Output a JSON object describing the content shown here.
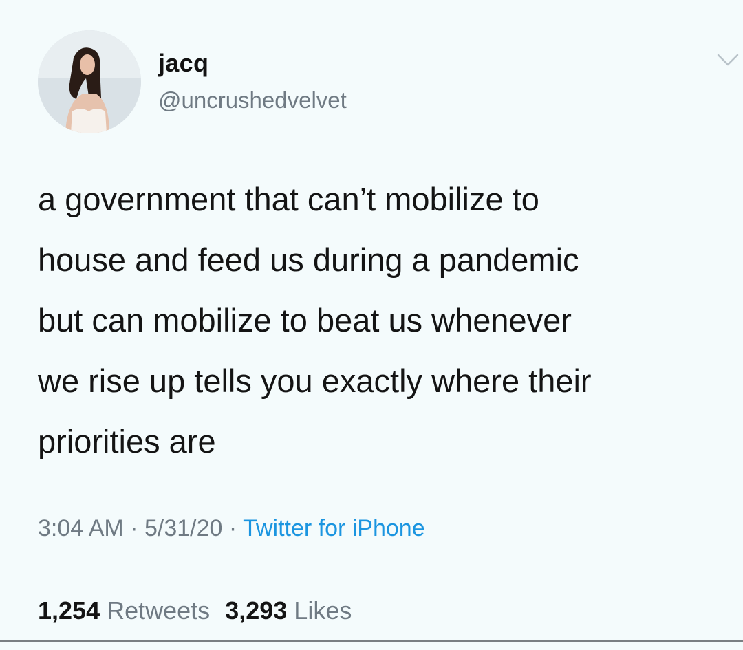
{
  "user": {
    "display_name": "jacq",
    "handle": "@uncrushedvelvet",
    "avatar_icon": "profile-photo"
  },
  "tweet": {
    "text": "a government that can’t mobilize to\nhouse and feed us during a pandemic\nbut can mobilize to beat us whenever\nwe rise up tells you exactly where their\npriorities are",
    "time": "3:04 AM",
    "date": "5/31/20",
    "separator": "·",
    "source": "Twitter for iPhone"
  },
  "stats": {
    "retweets_count": "1,254",
    "retweets_label": "Retweets",
    "likes_count": "3,293",
    "likes_label": "Likes"
  },
  "icons": {
    "menu": "chevron-down-icon"
  },
  "colors": {
    "background": "#f4fbfc",
    "link": "#1b95e0",
    "secondary_text": "#6f7a83"
  }
}
